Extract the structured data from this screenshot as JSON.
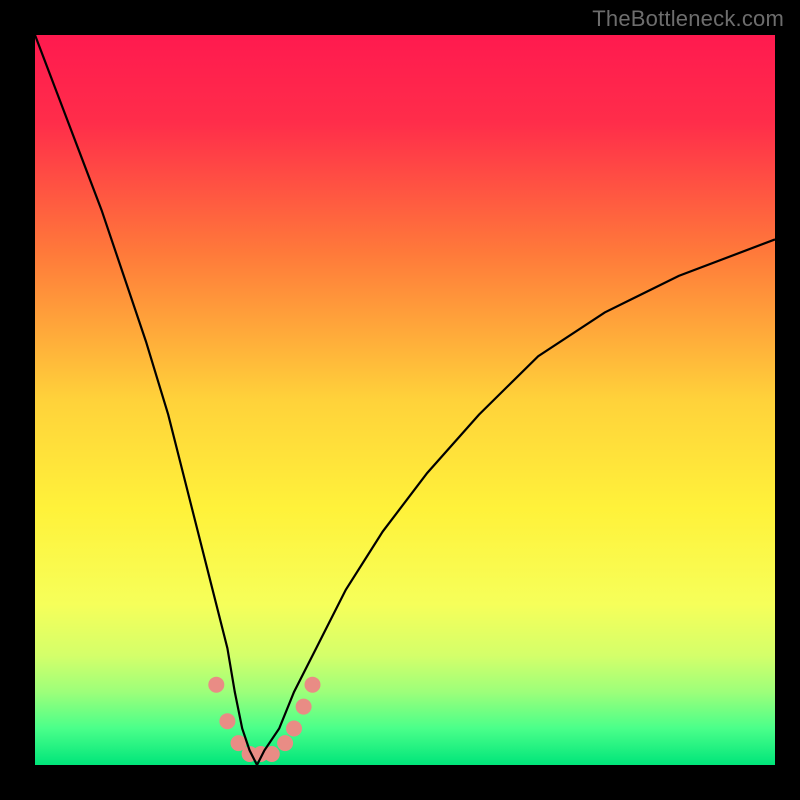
{
  "watermark": "TheBottleneck.com",
  "chart_data": {
    "type": "line",
    "title": "",
    "xlabel": "",
    "ylabel": "",
    "xlim": [
      0,
      100
    ],
    "ylim": [
      0,
      100
    ],
    "grid": false,
    "legend": false,
    "gradient_stops": [
      {
        "pct": 0,
        "color": "#ff1a4f"
      },
      {
        "pct": 12,
        "color": "#ff2d4a"
      },
      {
        "pct": 30,
        "color": "#ff7a3a"
      },
      {
        "pct": 50,
        "color": "#ffd23a"
      },
      {
        "pct": 65,
        "color": "#fff23a"
      },
      {
        "pct": 78,
        "color": "#f6ff5a"
      },
      {
        "pct": 85,
        "color": "#d4ff6a"
      },
      {
        "pct": 90,
        "color": "#9dff7a"
      },
      {
        "pct": 95,
        "color": "#4aff8a"
      },
      {
        "pct": 100,
        "color": "#00e57a"
      }
    ],
    "series": [
      {
        "name": "bottleneck-curve",
        "color": "#000000",
        "x": [
          0,
          3,
          6,
          9,
          12,
          15,
          18,
          20,
          22,
          24,
          26,
          27,
          28,
          29,
          30,
          31,
          33,
          35,
          38,
          42,
          47,
          53,
          60,
          68,
          77,
          87,
          100
        ],
        "y": [
          100,
          92,
          84,
          76,
          67,
          58,
          48,
          40,
          32,
          24,
          16,
          10,
          5,
          2,
          0,
          2,
          5,
          10,
          16,
          24,
          32,
          40,
          48,
          56,
          62,
          67,
          72
        ]
      }
    ],
    "markers": {
      "name": "highlight-points",
      "color": "#e98c85",
      "radius": 8,
      "points": [
        {
          "x": 24.5,
          "y": 11
        },
        {
          "x": 26.0,
          "y": 6
        },
        {
          "x": 27.5,
          "y": 3
        },
        {
          "x": 29.0,
          "y": 1.5
        },
        {
          "x": 30.5,
          "y": 1.5
        },
        {
          "x": 32.0,
          "y": 1.5
        },
        {
          "x": 33.8,
          "y": 3
        },
        {
          "x": 35.0,
          "y": 5
        },
        {
          "x": 36.3,
          "y": 8
        },
        {
          "x": 37.5,
          "y": 11
        }
      ]
    }
  }
}
